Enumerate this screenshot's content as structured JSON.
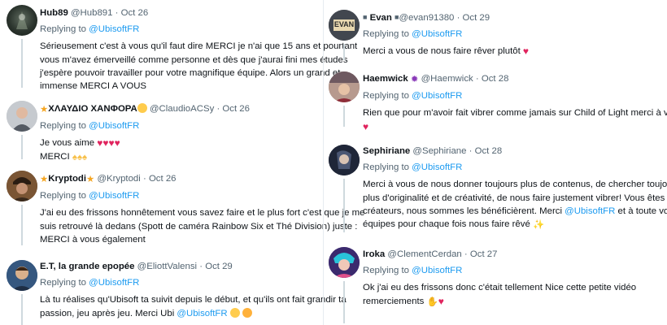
{
  "left": [
    {
      "name": "Hub89",
      "handle": "@Hub891",
      "date": "Oct 26",
      "replying_to": "Replying to",
      "mention": "@UbisoftFR",
      "lines": [
        "Sérieusement c'est à vous qu'il faut dire MERCI je n'ai que 15 ans et pourtant",
        "vous m'avez émerveillé comme personne et dès que j'aurai fini mes études",
        "j'espère pouvoir travailler pour votre magnifique équipe. Alors un grand et",
        "immense MERCI A VOUS"
      ]
    },
    {
      "name": "ΧΛΑΥΔΙΟ ΧΑΝΦΟΡΑ",
      "handle": "@ClaudioACSy",
      "date": "Oct 26",
      "replying_to": "Replying to",
      "mention": "@UbisoftFR",
      "line1": "Je vous aime",
      "line2": "MERCI"
    },
    {
      "name": "Kryptodi",
      "handle": "@Kryptodi",
      "date": "Oct 26",
      "replying_to": "Replying to",
      "mention": "@UbisoftFR",
      "lines": [
        "J'ai eu des frissons honnêtement vous savez faire et le plus fort c'est que je me",
        "suis retrouvé là dedans (Spott de caméra Rainbow Six et Thé Division) juste :",
        "MERCI à vous également"
      ]
    },
    {
      "name": "E.T, la grande epopée",
      "handle": "@EliottValensi",
      "date": "Oct 29",
      "replying_to": "Replying to",
      "mention": "@UbisoftFR",
      "line1": "Là tu réalises qu'Ubisoft ta suivit depuis le début, et qu'ils ont fait grandir ta",
      "line2": "passion, jeu après jeu. Merci Ubi",
      "line2_mention": "@UbisoftFR"
    }
  ],
  "right": [
    {
      "name": "Evan",
      "handle": "@evan91380",
      "date": "Oct 29",
      "replying_to": "Replying to",
      "mention": "@UbisoftFR",
      "text": "Merci a vous de nous faire rêver plutôt",
      "avatar_label": "EVAN"
    },
    {
      "name": "Haemwick",
      "handle": "@Haemwick",
      "date": "Oct 28",
      "replying_to": "Replying to",
      "mention": "@UbisoftFR",
      "text": "Rien que pour m'avoir fait vibrer comme jamais sur Child of Light merci à vous."
    },
    {
      "name": "Sephiriane",
      "handle": "@Sephiriane",
      "date": "Oct 28",
      "replying_to": "Replying to",
      "mention": "@UbisoftFR",
      "lines": [
        "Merci à vous de nous donner toujours plus de contenus, de chercher toujours",
        "plus d'originalité et de créativité,  de nous faire justement vibrer!  Vous êtes les",
        "créateurs,  nous sommes les bénéficièrent.  Merci"
      ],
      "line3_mention": "@UbisoftFR",
      "line3_tail": "et à toute vos",
      "line4": "équipes pour chaque fois nous faire rêvé"
    },
    {
      "name": "Iroka",
      "handle": "@ClementCerdan",
      "date": "Oct 27",
      "replying_to": "Replying to",
      "mention": "@UbisoftFR",
      "line1": "Ok j'ai eu des frissons donc c'était tellement Nice cette petite vidéo",
      "line2": "remerciements"
    }
  ],
  "separator": "·",
  "icons": {
    "heart": "red-heart",
    "star": "glowing-star",
    "heart_eyes": "smiling-face-heart-eyes",
    "pray": "folded-hands",
    "grin": "grinning-face",
    "ok_hand": "ok-hand",
    "sparkle": "sparkles",
    "octopus": "octopus"
  },
  "colors": {
    "link": "#1d9bf0",
    "heart": "#e0245e",
    "muted": "#536471",
    "text": "#0f1419"
  }
}
